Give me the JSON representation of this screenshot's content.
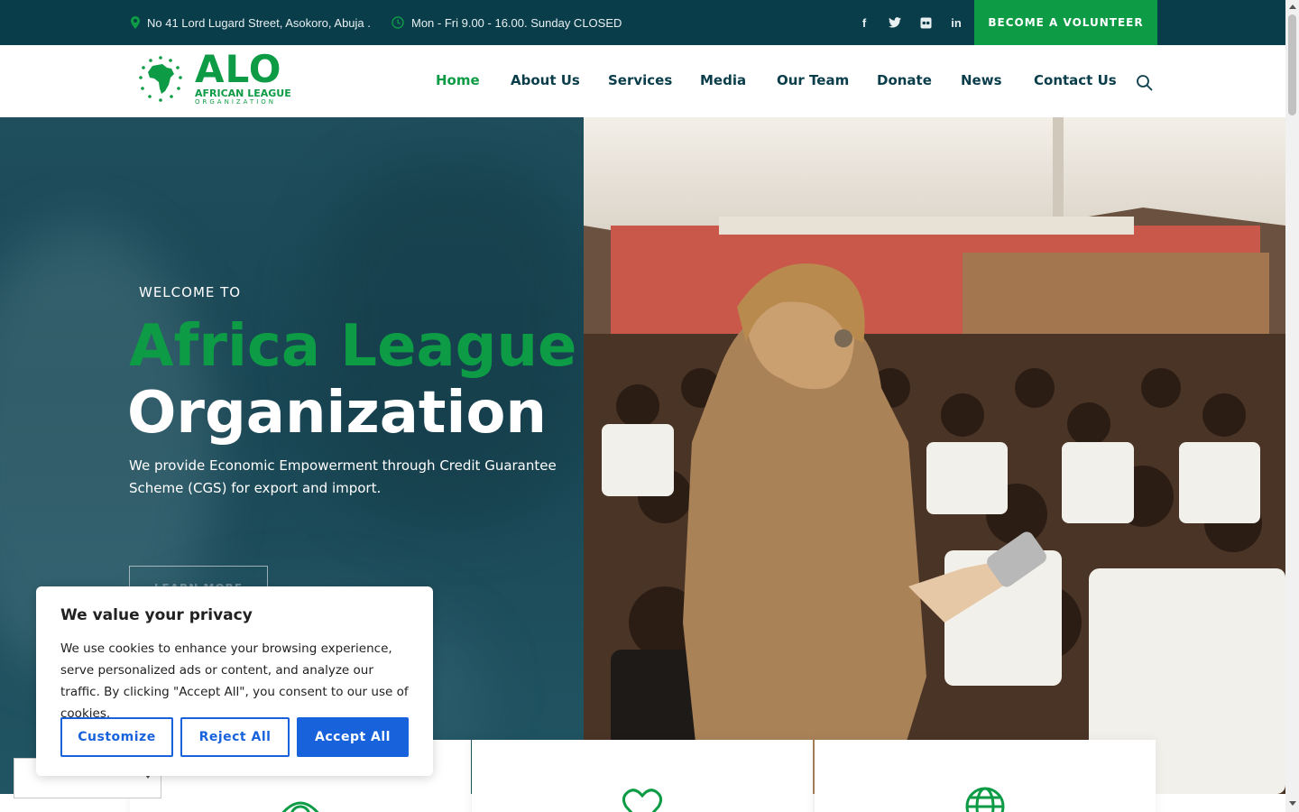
{
  "topbar": {
    "address": "No 41 Lord Lugard Street, Asokoro, Abuja .",
    "hours": "Mon - Fri 9.00 - 16.00. Sunday CLOSED",
    "social": {
      "facebook": "f",
      "twitter": "twitter-icon",
      "flickr": "flickr-icon",
      "linkedin": "in"
    },
    "volunteer_label": "BECOME A VOLUNTEER"
  },
  "logo": {
    "main": "ALO",
    "line1": "AFRICAN LEAGUE",
    "line2": "ORGANIZATION"
  },
  "nav": {
    "items": [
      {
        "label": "Home",
        "active": true
      },
      {
        "label": "About Us"
      },
      {
        "label": "Services"
      },
      {
        "label": "Media"
      },
      {
        "label": "Our Team"
      },
      {
        "label": "Donate"
      },
      {
        "label": "News"
      },
      {
        "label": "Contact Us"
      }
    ],
    "search_icon": "search-icon"
  },
  "hero": {
    "welcome": "WELCOME TO",
    "title_green": "Africa League",
    "title_white": "Organization",
    "lead": "We provide Economic Empowerment through Credit Guarantee Scheme (CGS) for export and import.",
    "button_label": "LEARN MORE"
  },
  "cards": [
    {
      "icon": "eye-icon"
    },
    {
      "icon": "heart-icon"
    },
    {
      "icon": "globe-icon"
    }
  ],
  "cookie": {
    "title": "We value your privacy",
    "text": "We use cookies to enhance your browsing experience, serve personalized ads or content, and analyze our traffic. By clicking \"Accept All\", you consent to our use of cookies.",
    "customize": "Customize",
    "reject": "Reject All",
    "accept": "Accept All"
  },
  "colors": {
    "brand_green": "#0d9b45",
    "dark_teal": "#0a3d4a",
    "cookie_blue": "#1863dc"
  }
}
